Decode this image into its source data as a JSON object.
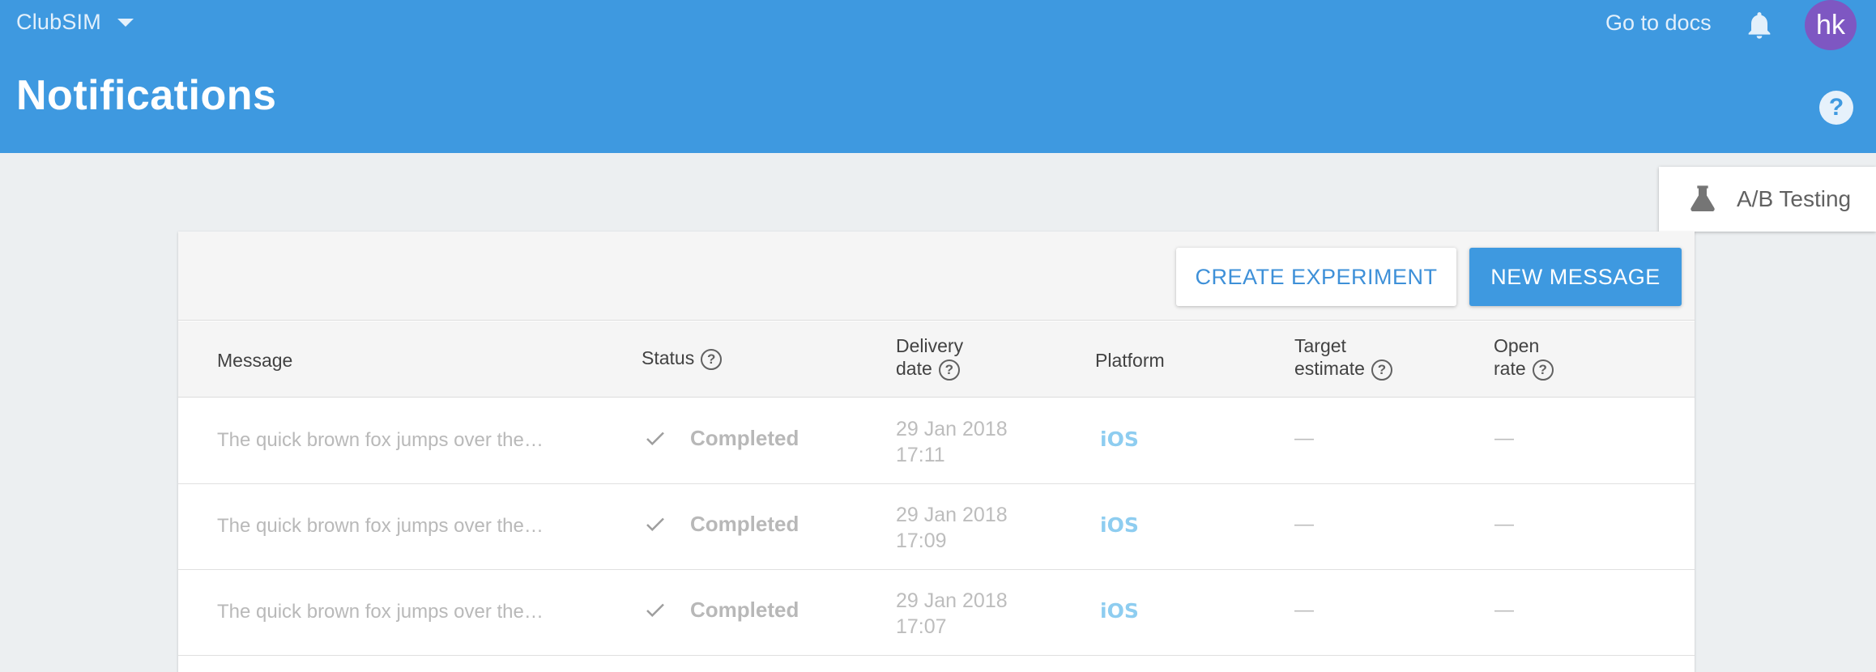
{
  "header": {
    "project_name": "ClubSIM",
    "goto_docs": "Go to docs",
    "avatar_initials": "hk",
    "page_title": "Notifications",
    "help": "?"
  },
  "ab_tab": {
    "label": "A/B Testing",
    "icon": "flask-icon"
  },
  "toolbar": {
    "create_experiment": "CREATE EXPERIMENT",
    "new_message": "NEW MESSAGE"
  },
  "table": {
    "columns": {
      "message": "Message",
      "status": "Status",
      "delivery_line1": "Delivery",
      "delivery_line2": "date",
      "platform": "Platform",
      "target_line1": "Target",
      "target_line2": "estimate",
      "open_line1": "Open",
      "open_line2": "rate"
    },
    "rows": [
      {
        "message": "The quick brown fox jumps over the…",
        "status": "Completed",
        "date": "29 Jan 2018",
        "time": "17:11",
        "platform": "iOS",
        "target": "—",
        "open_rate": "—"
      },
      {
        "message": "The quick brown fox jumps over the…",
        "status": "Completed",
        "date": "29 Jan 2018",
        "time": "17:09",
        "platform": "iOS",
        "target": "—",
        "open_rate": "—"
      },
      {
        "message": "The quick brown fox jumps over the…",
        "status": "Completed",
        "date": "29 Jan 2018",
        "time": "17:07",
        "platform": "iOS",
        "target": "—",
        "open_rate": "—"
      }
    ]
  },
  "colors": {
    "header_blue": "#3e99e0",
    "avatar_purple": "#7e57c2",
    "background": "#eceff1"
  }
}
